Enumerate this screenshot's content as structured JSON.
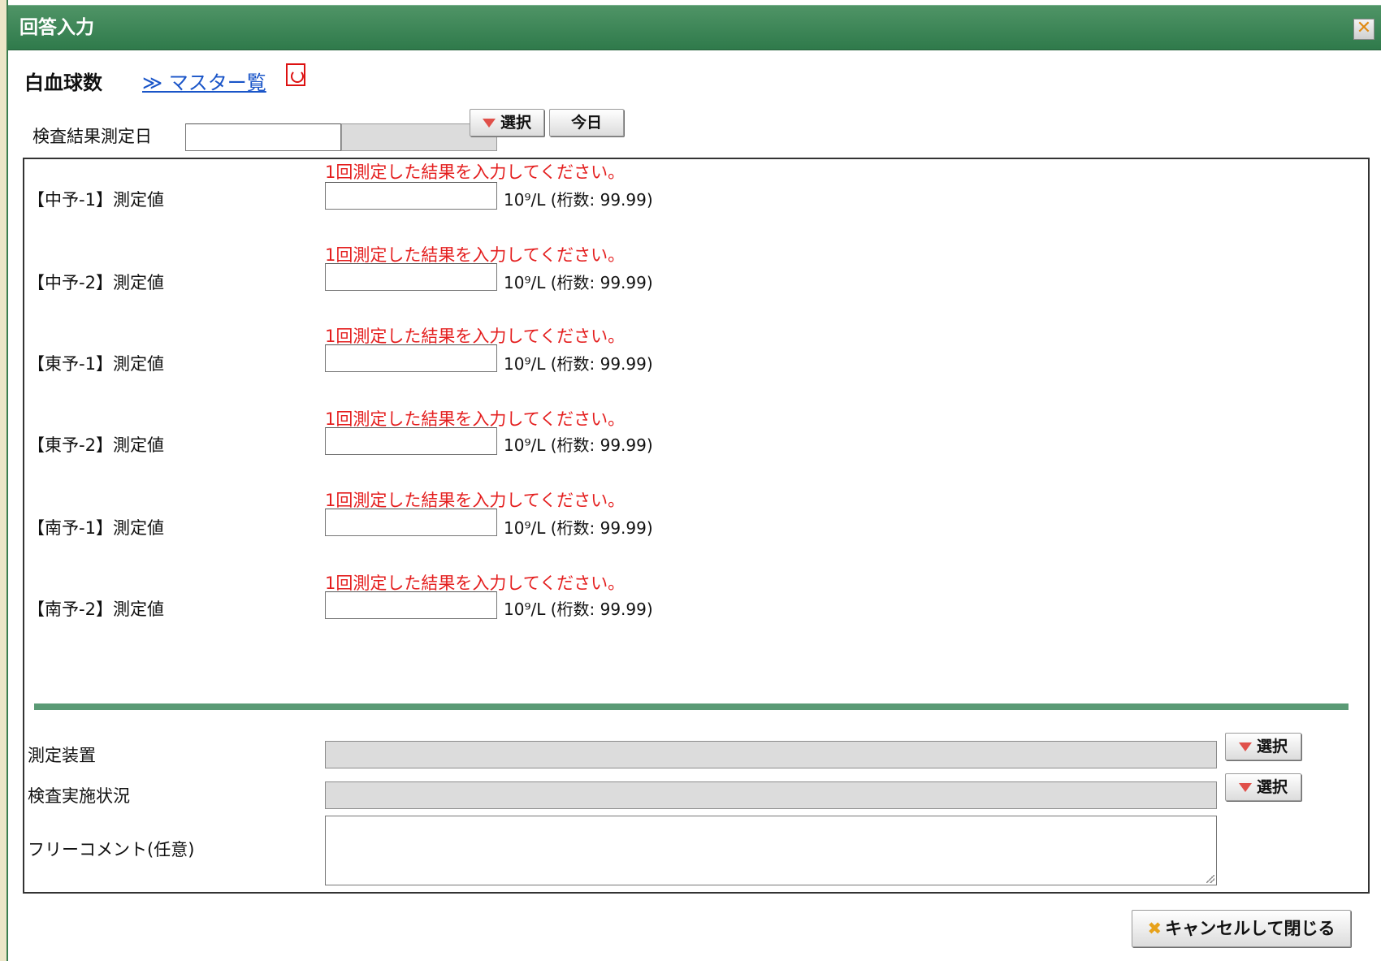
{
  "window": {
    "title": "回答入力",
    "close_icon": "close-icon"
  },
  "header": {
    "subject": "白血球数",
    "master_link": "≫ マスター覧",
    "pdf_icon": "pdf-icon"
  },
  "date": {
    "label": "検査結果測定日",
    "select_label": "選択",
    "today_label": "今日"
  },
  "measurements": [
    {
      "notice": "1回測定した結果を入力してください。",
      "label": "【中予-1】測定値",
      "unit": "10⁹/L (桁数: 99.99)",
      "value": ""
    },
    {
      "notice": "1回測定した結果を入力してください。",
      "label": "【中予-2】測定値",
      "unit": "10⁹/L (桁数: 99.99)",
      "value": ""
    },
    {
      "notice": "1回測定した結果を入力してください。",
      "label": "【東予-1】測定値",
      "unit": "10⁹/L (桁数: 99.99)",
      "value": ""
    },
    {
      "notice": "1回測定した結果を入力してください。",
      "label": "【東予-2】測定値",
      "unit": "10⁹/L (桁数: 99.99)",
      "value": ""
    },
    {
      "notice": "1回測定した結果を入力してください。",
      "label": "【南予-1】測定値",
      "unit": "10⁹/L (桁数: 99.99)",
      "value": ""
    },
    {
      "notice": "1回測定した結果を入力してください。",
      "label": "【南予-2】測定値",
      "unit": "10⁹/L (桁数: 99.99)",
      "value": ""
    }
  ],
  "device": {
    "label": "測定装置",
    "select_label": "選択"
  },
  "status": {
    "label": "検査実施状況",
    "select_label": "選択"
  },
  "comment": {
    "label": "フリーコメント(任意)"
  },
  "footer": {
    "cancel_label": "キャンセルして閉じる"
  }
}
